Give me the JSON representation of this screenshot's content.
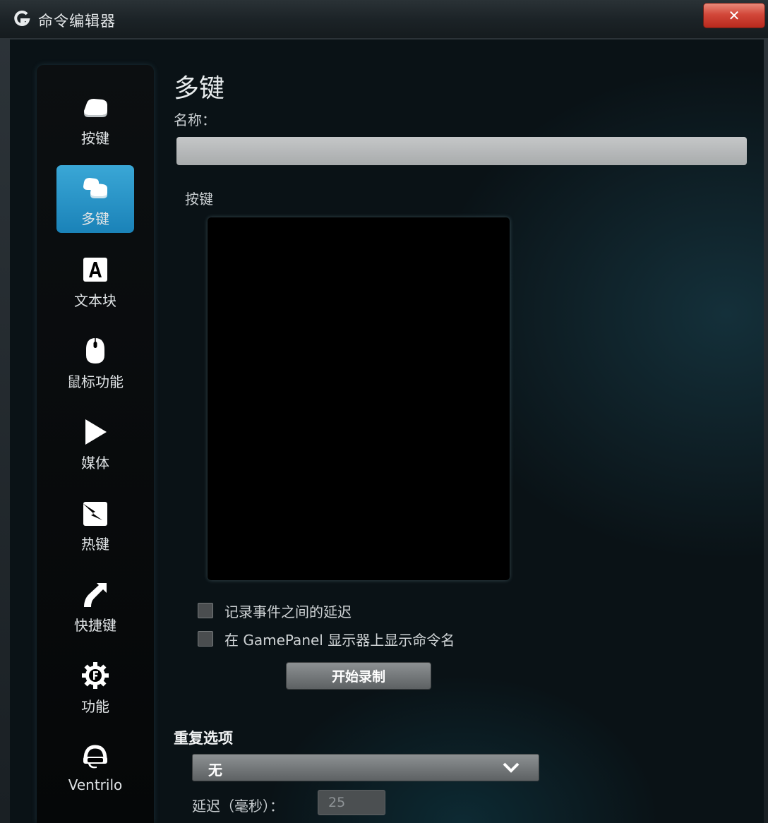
{
  "window": {
    "title": "命令编辑器",
    "close_label": "✕"
  },
  "sidebar": {
    "items": [
      {
        "label": "按键",
        "icon": "key-icon",
        "active": false
      },
      {
        "label": "多键",
        "icon": "multi-key-icon",
        "active": true
      },
      {
        "label": "文本块",
        "icon": "text-block-icon",
        "active": false
      },
      {
        "label": "鼠标功能",
        "icon": "mouse-icon",
        "active": false
      },
      {
        "label": "媒体",
        "icon": "play-icon",
        "active": false
      },
      {
        "label": "热键",
        "icon": "hotkey-icon",
        "active": false
      },
      {
        "label": "快捷键",
        "icon": "shortcut-arrow-icon",
        "active": false
      },
      {
        "label": "功能",
        "icon": "function-gear-icon",
        "active": false
      },
      {
        "label": "Ventrilo",
        "icon": "headset-icon",
        "active": false
      }
    ]
  },
  "main": {
    "title": "多键",
    "name_label": "名称：",
    "name_value": "",
    "keys_label": "按键",
    "checkboxes": [
      {
        "label": "记录事件之间的延迟",
        "checked": false
      },
      {
        "label": "在 GamePanel 显示器上显示命令名",
        "checked": false
      }
    ],
    "record_button": "开始录制",
    "repeat_label": "重复选项",
    "repeat_value": "无",
    "delay_label": "延迟（毫秒）：",
    "delay_value": "25"
  },
  "colors": {
    "accent": "#2a96c9",
    "close": "#c9392b"
  }
}
